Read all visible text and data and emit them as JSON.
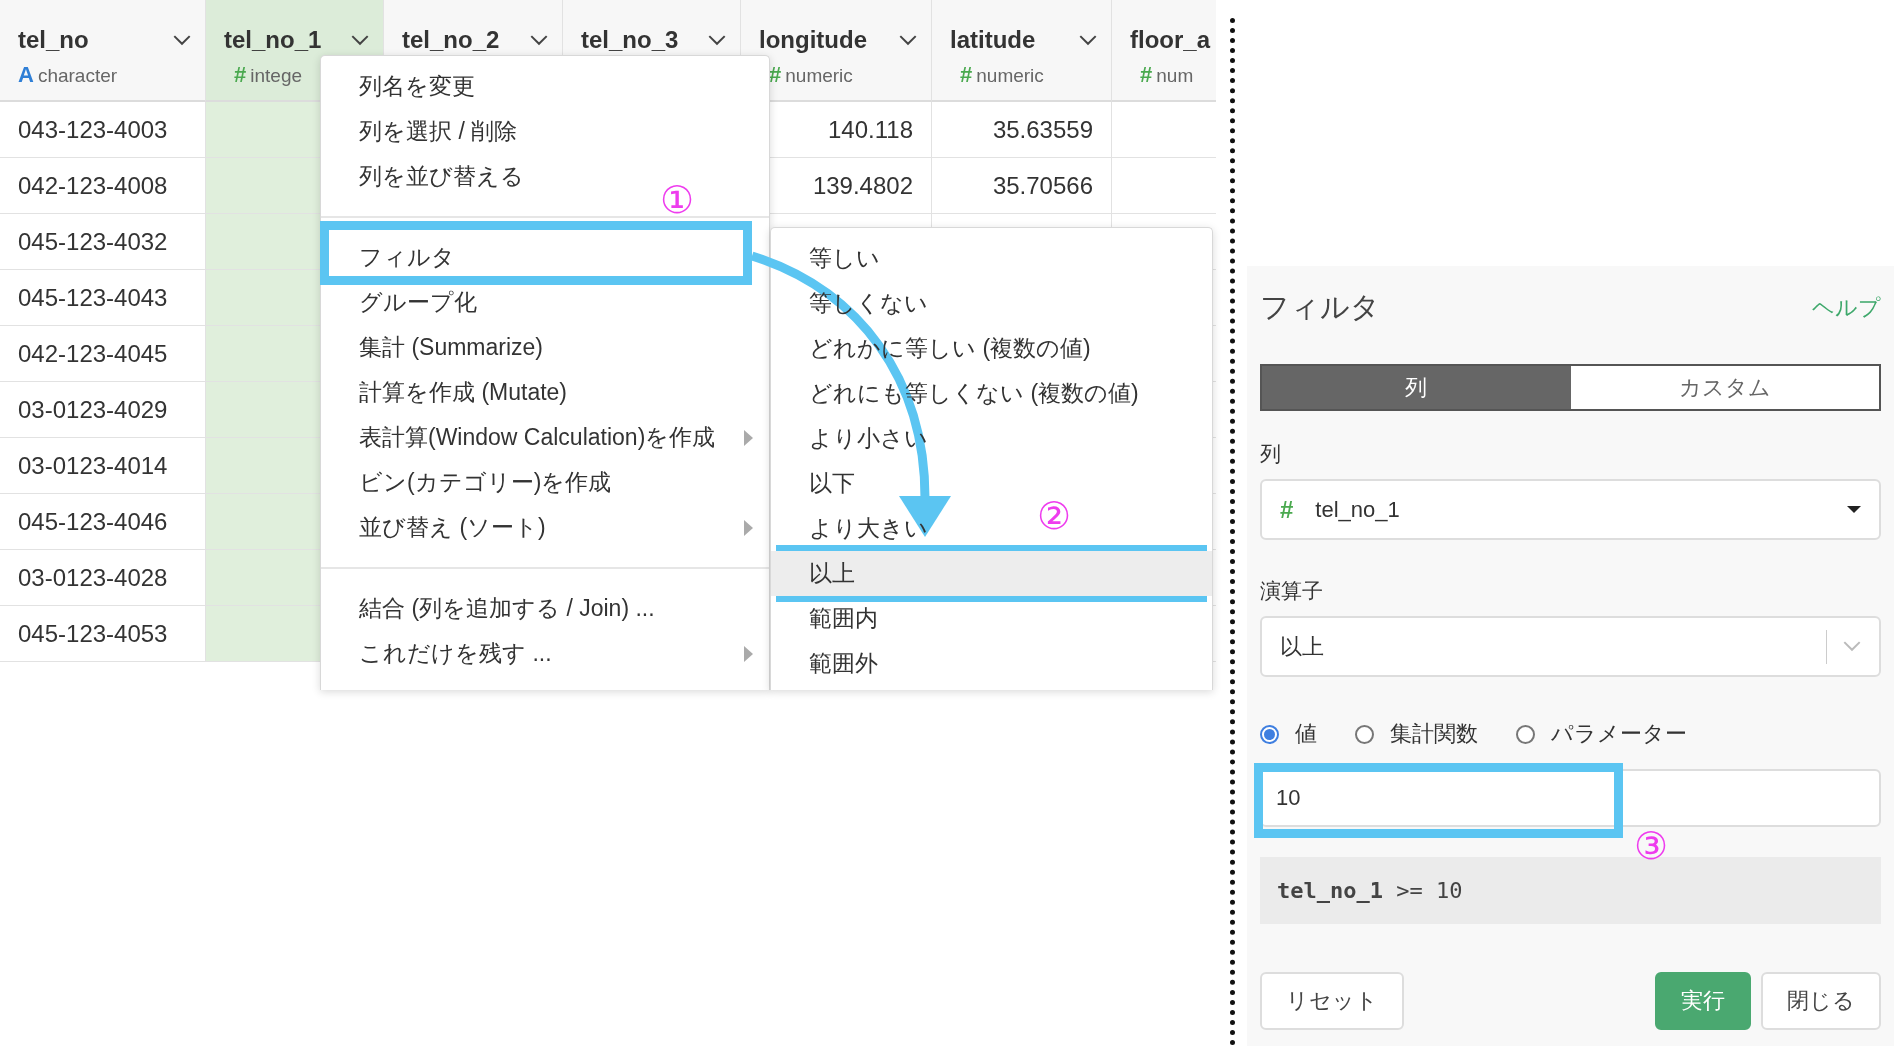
{
  "table": {
    "columns": [
      {
        "name": "tel_no",
        "kind": "text",
        "type_icon": "A",
        "type": "character",
        "selected": false
      },
      {
        "name": "tel_no_1",
        "kind": "number",
        "type_icon": "#",
        "type": "intege",
        "selected": true
      },
      {
        "name": "tel_no_2",
        "selected": false
      },
      {
        "name": "tel_no_3",
        "selected": false
      },
      {
        "name": "longitude",
        "kind": "number",
        "type_icon": "#",
        "type": "numeric",
        "selected": false
      },
      {
        "name": "latitude",
        "kind": "number",
        "type_icon": "#",
        "type": "numeric",
        "selected": false
      },
      {
        "name": "floor_a",
        "kind": "number",
        "type_icon": "#",
        "type": "num",
        "selected": false
      }
    ],
    "rows": [
      {
        "cells": [
          "043-123-4003",
          null,
          null,
          null,
          "140.118",
          "35.63559",
          null
        ]
      },
      {
        "cells": [
          "042-123-4008",
          null,
          null,
          null,
          "139.4802",
          "35.70566",
          null
        ]
      },
      {
        "cells": [
          "045-123-4032",
          null,
          null,
          null,
          null,
          null,
          null
        ]
      },
      {
        "cells": [
          "045-123-4043",
          null,
          null,
          null,
          null,
          null,
          null
        ]
      },
      {
        "cells": [
          "042-123-4045",
          null,
          null,
          null,
          null,
          null,
          null
        ]
      },
      {
        "cells": [
          "03-0123-4029",
          null,
          null,
          null,
          null,
          null,
          null
        ]
      },
      {
        "cells": [
          "03-0123-4014",
          null,
          null,
          null,
          null,
          null,
          null
        ]
      },
      {
        "cells": [
          "045-123-4046",
          null,
          null,
          null,
          null,
          null,
          null
        ]
      },
      {
        "cells": [
          "03-0123-4028",
          null,
          null,
          null,
          null,
          null,
          null
        ]
      },
      {
        "cells": [
          "045-123-4053",
          null,
          null,
          null,
          null,
          null,
          null
        ]
      }
    ]
  },
  "column_menu": {
    "items": [
      {
        "kind": "item",
        "label": "列名を変更",
        "has_submenu": false
      },
      {
        "kind": "item",
        "label": "列を選択 / 削除",
        "has_submenu": false
      },
      {
        "kind": "item",
        "label": "列を並び替える",
        "has_submenu": false
      },
      {
        "kind": "divider"
      },
      {
        "kind": "item",
        "label": "フィルタ",
        "has_submenu": false
      },
      {
        "kind": "item",
        "label": "グループ化",
        "has_submenu": false
      },
      {
        "kind": "item",
        "label": "集計 (Summarize)",
        "has_submenu": false
      },
      {
        "kind": "item",
        "label": "計算を作成 (Mutate)",
        "has_submenu": false
      },
      {
        "kind": "item",
        "label": "表計算(Window Calculation)を作成",
        "has_submenu": true
      },
      {
        "kind": "item",
        "label": "ビン(カテゴリー)を作成",
        "has_submenu": false
      },
      {
        "kind": "item",
        "label": "並び替え (ソート)",
        "has_submenu": true
      },
      {
        "kind": "divider"
      },
      {
        "kind": "item",
        "label": "結合 (列を追加する / Join) ...",
        "has_submenu": false
      },
      {
        "kind": "item",
        "label": "これだけを残す ...",
        "has_submenu": true
      }
    ]
  },
  "filter_submenu": {
    "items": [
      {
        "label": "等しい",
        "selected": false
      },
      {
        "label": "等しくない",
        "selected": false
      },
      {
        "label": "どれかに等しい (複数の値)",
        "selected": false
      },
      {
        "label": "どれにも等しくない (複数の値)",
        "selected": false
      },
      {
        "label": "より小さい",
        "selected": false
      },
      {
        "label": "以下",
        "selected": false
      },
      {
        "label": "より大きい",
        "selected": false
      },
      {
        "label": "以上",
        "selected": true
      },
      {
        "label": "範囲内",
        "selected": false
      },
      {
        "label": "範囲外",
        "selected": false
      }
    ]
  },
  "filter_panel": {
    "title": "フィルタ",
    "help": "ヘルプ",
    "tabs": [
      {
        "label": "列",
        "selected": true
      },
      {
        "label": "カスタム",
        "selected": false
      }
    ],
    "column_label": "列",
    "column_select": {
      "type_icon": "#",
      "value": "tel_no_1"
    },
    "operator_label": "演算子",
    "operator_select": {
      "value": "以上"
    },
    "value_sources": [
      {
        "label": "値",
        "selected": true
      },
      {
        "label": "集計関数",
        "selected": false
      },
      {
        "label": "パラメーター",
        "selected": false
      }
    ],
    "value_input": {
      "value": "10"
    },
    "expression": "**tel_no_1** >= 10",
    "buttons": [
      {
        "label": "リセット",
        "kind": "default"
      },
      {
        "label": "実行",
        "kind": "primary"
      },
      {
        "label": "閉じる",
        "kind": "default"
      }
    ]
  },
  "annotations": {
    "step_labels": [
      "①",
      "②",
      "③"
    ]
  }
}
